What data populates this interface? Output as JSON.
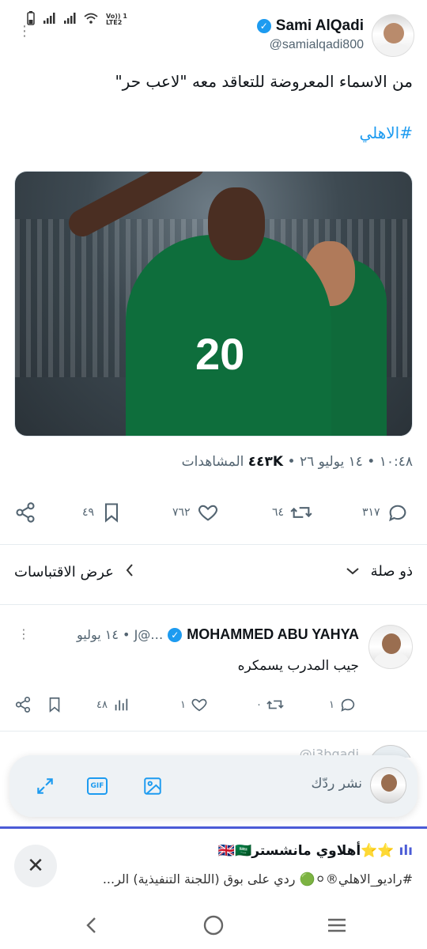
{
  "status_bar": {
    "battery_icon": "battery-icon",
    "signal_icons": [
      "signal-icon",
      "signal-icon",
      "wifi-icon"
    ],
    "lte_label_1": "Vo)) 1",
    "lte_label_2": "LTE2"
  },
  "tweet": {
    "display_name": "Sami AlQadi",
    "handle": "@samialqadi800",
    "text": "من الاسماء المعروضة للتعاقد معه \"لاعب حر\"",
    "hashtag": "#الاهلي",
    "media": {
      "description_icon": "photo-football-player",
      "shirt_number": "20"
    },
    "meta": {
      "time_date": "١٠:٤٨ • ١٤ يوليو ٢٦ •",
      "views_count": "٤٤٣K",
      "views_label": "المشاهدات"
    },
    "actions": {
      "replies": "٣١٧",
      "retweets": "٦٤",
      "likes": "٧٦٢",
      "bookmarks": "٤٩"
    }
  },
  "filters": {
    "relevance": "ذو صلة",
    "quotes": "عرض الاقتباسات"
  },
  "reply": {
    "name": "MOHAMMED ABU YAHYA",
    "handle_date": "…@J • ١٤ يوليو",
    "text": "جيب المدرب يسمكره",
    "actions": {
      "replies": "١",
      "retweets": "٠",
      "likes": "١",
      "views": "٤٨"
    }
  },
  "peek": {
    "text": "@j3bqadi"
  },
  "composer": {
    "placeholder": "نشر ردّك",
    "gif_label": "GIF"
  },
  "notification": {
    "title": "⭐⭐أهلاوي مانشستر🇬🇧🇸🇦",
    "bars_icon": "ılı",
    "body": "#راديو_الاهلي®⚪🟢 ردي على بوق (اللجنة التنفيذية) الر..."
  },
  "colors": {
    "accent": "#1d9bf0",
    "secondary_text": "#536471",
    "notification_accent": "#4b5bd6"
  }
}
